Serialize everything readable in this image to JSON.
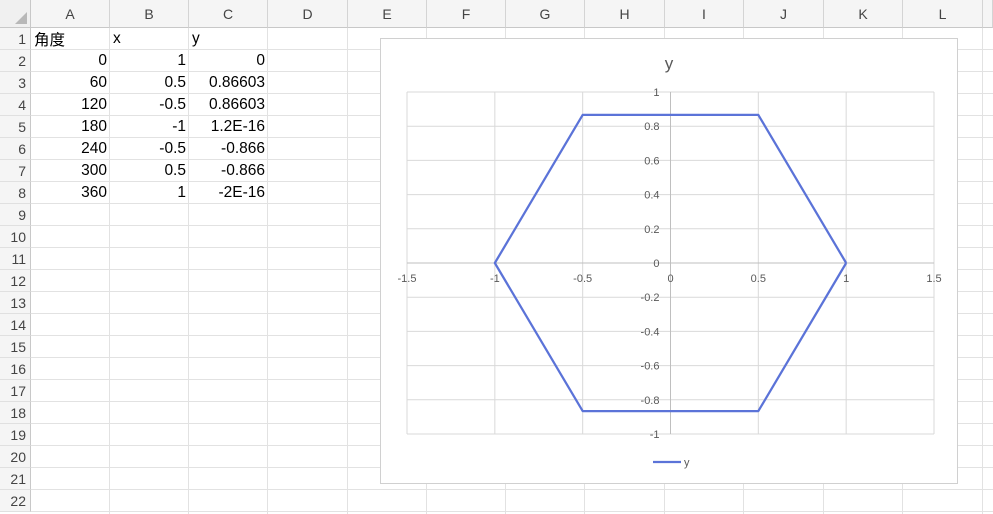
{
  "sheet": {
    "columns": [
      "A",
      "B",
      "C",
      "D",
      "E",
      "F",
      "G",
      "H",
      "I",
      "J",
      "K",
      "L"
    ],
    "rows": [
      "1",
      "2",
      "3",
      "4",
      "5",
      "6",
      "7",
      "8",
      "9",
      "10",
      "11",
      "12",
      "13",
      "14",
      "15",
      "16",
      "17",
      "18",
      "19",
      "20",
      "21",
      "22"
    ],
    "cells": {
      "A1": "角度",
      "B1": "x",
      "C1": "y",
      "A2": "0",
      "B2": "1",
      "C2": "0",
      "A3": "60",
      "B3": "0.5",
      "C3": "0.86603",
      "A4": "120",
      "B4": "-0.5",
      "C4": "0.86603",
      "A5": "180",
      "B5": "-1",
      "C5": "1.2E-16",
      "A6": "240",
      "B6": "-0.5",
      "C6": "-0.866",
      "A7": "300",
      "B7": "0.5",
      "C7": "-0.866",
      "A8": "360",
      "B8": "1",
      "C8": "-2E-16"
    }
  },
  "chart_data": {
    "type": "scatter",
    "title": "y",
    "xlim": [
      -1.5,
      1.5
    ],
    "ylim": [
      -1,
      1
    ],
    "x_ticks": [
      "-1.5",
      "-1",
      "-0.5",
      "0",
      "0.5",
      "1",
      "1.5"
    ],
    "y_ticks": [
      "1",
      "0.8",
      "0.6",
      "0.4",
      "0.2",
      "0",
      "-0.2",
      "-0.4",
      "-0.6",
      "-0.8",
      "-1"
    ],
    "grid": true,
    "legend": "bottom",
    "series": [
      {
        "name": "y",
        "color": "#5b73d8",
        "points": [
          [
            1,
            0
          ],
          [
            0.5,
            0.86603
          ],
          [
            -0.5,
            0.86603
          ],
          [
            -1,
            1.2e-16
          ],
          [
            -0.5,
            -0.866
          ],
          [
            0.5,
            -0.866
          ],
          [
            1,
            -2e-16
          ]
        ]
      }
    ]
  }
}
